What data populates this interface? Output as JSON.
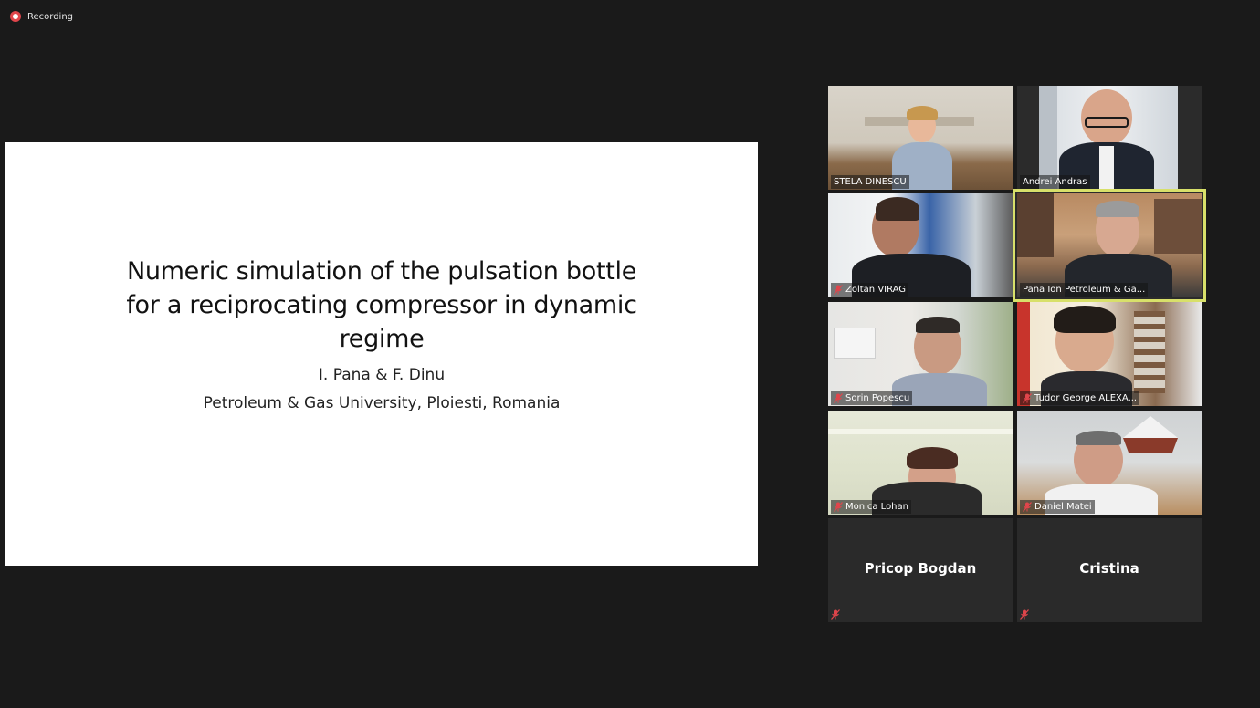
{
  "recording": {
    "label": "Recording",
    "color": "#e0454b"
  },
  "slide": {
    "title_lines": [
      "Numeric simulation of the pulsation bottle",
      "for a reciprocating compressor in dynamic",
      "regime"
    ],
    "authors": "I. Pana & F. Dinu",
    "affiliation": "Petroleum & Gas University, Ploiesti, Romania"
  },
  "participants": [
    {
      "name": "STELA DINESCU",
      "muted": false,
      "video": true
    },
    {
      "name": "Andrei Andras",
      "muted": false,
      "video": true
    },
    {
      "name": "Zoltan VIRAG",
      "muted": true,
      "video": true
    },
    {
      "name": "Pana Ion Petroleum & Ga...",
      "muted": false,
      "video": true,
      "speaking": true
    },
    {
      "name": "Sorin Popescu",
      "muted": true,
      "video": true
    },
    {
      "name": "Tudor George ALEXA...",
      "muted": true,
      "video": true
    },
    {
      "name": "Monica Lohan",
      "muted": true,
      "video": true
    },
    {
      "name": "Daniel Matei",
      "muted": true,
      "video": true
    },
    {
      "name": "Pricop Bogdan",
      "muted": true,
      "video": false
    },
    {
      "name": "Cristina",
      "muted": true,
      "video": false
    }
  ],
  "colors": {
    "background": "#1a1a1a",
    "active_speaker_border": "#d8e06a",
    "muted_icon": "#e0454b"
  }
}
